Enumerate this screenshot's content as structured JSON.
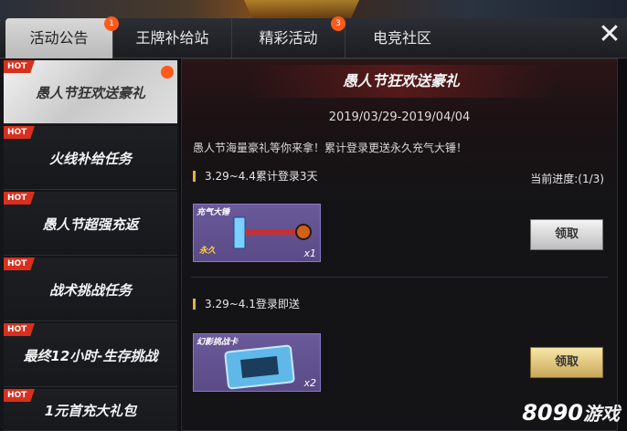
{
  "tabs": [
    {
      "label": "活动公告",
      "badge": "1"
    },
    {
      "label": "王牌补给站",
      "badge": ""
    },
    {
      "label": "精彩活动",
      "badge": "3"
    },
    {
      "label": "电竞社区",
      "badge": ""
    }
  ],
  "close_icon": "close-icon",
  "sidebar": {
    "items": [
      {
        "hot": "HOT",
        "label": "愚人节狂欢送豪礼"
      },
      {
        "hot": "HOT",
        "label": "火线补给任务"
      },
      {
        "hot": "HOT",
        "label": "愚人节超强充返"
      },
      {
        "hot": "HOT",
        "label": "战术挑战任务"
      },
      {
        "hot": "HOT",
        "label": "最终12小时-生存挑战"
      },
      {
        "hot": "HOT",
        "label": "1元首充大礼包"
      }
    ]
  },
  "main": {
    "title": "愚人节狂欢送豪礼",
    "date": "2019/03/29-2019/04/04",
    "description": "愚人节海量豪礼等你来拿！累计登录更送永久充气大锤！",
    "sections": [
      {
        "heading": "3.29~4.4累计登录3天",
        "progress": "当前进度:(1/3)",
        "reward": {
          "name": "充气大锤",
          "tag": "永久",
          "qty": "x1"
        },
        "button": "领取"
      },
      {
        "heading": "3.29~4.1登录即送",
        "progress": "",
        "reward": {
          "name": "幻影挑战卡",
          "tag": "",
          "qty": "x2"
        },
        "button": "领取"
      }
    ]
  },
  "watermark": {
    "number": "8090",
    "text": "游戏"
  },
  "colors": {
    "hot_badge": "#d8301e",
    "notify_dot": "#ff5a1a",
    "accent_gold": "#e0b43a"
  }
}
